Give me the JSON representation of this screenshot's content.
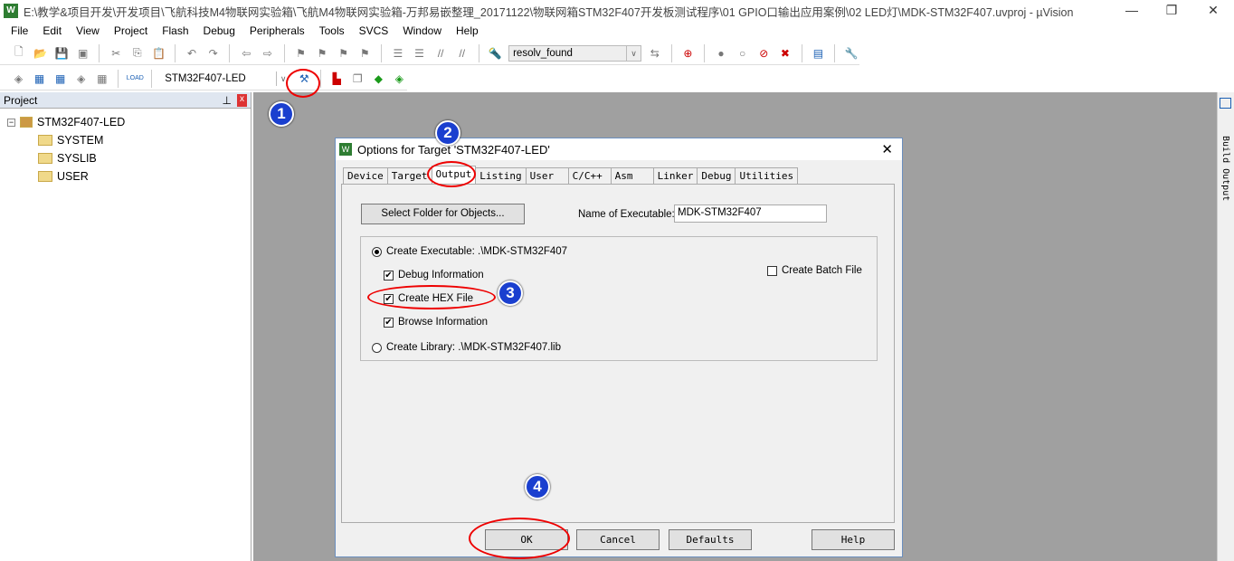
{
  "window": {
    "title": "E:\\教学&项目开发\\开发项目\\飞航科技M4物联网实验箱\\飞航M4物联网实验箱-万邦易嵌整理_20171122\\物联网箱STM32F407开发板测试程序\\01 GPIO口输出应用案例\\02 LED灯\\MDK-STM32F407.uvproj - µVision",
    "logo": "W",
    "minimize": "—",
    "maximize": "❐",
    "close": "✕"
  },
  "menu": [
    "File",
    "Edit",
    "View",
    "Project",
    "Flash",
    "Debug",
    "Peripherals",
    "Tools",
    "SVCS",
    "Window",
    "Help"
  ],
  "toolbar": {
    "find_combo": "resolv_found",
    "target_combo": "STM32F407-LED",
    "load_label": "LOAD"
  },
  "project": {
    "header": "Project",
    "pin": "⊥",
    "close": "x",
    "root": "STM32F407-LED",
    "groups": [
      "SYSTEM",
      "SYSLIB",
      "USER"
    ]
  },
  "build_output": "Build Output",
  "dialog": {
    "title": "Options for Target 'STM32F407-LED'",
    "close": "✕",
    "tabs": [
      "Device",
      "Target",
      "Output",
      "Listing",
      "User",
      "C/C++",
      "Asm",
      "Linker",
      "Debug",
      "Utilities"
    ],
    "active_tab": "Output",
    "select_folder": "Select Folder for Objects...",
    "name_label": "Name of Executable:",
    "name_value": "MDK-STM32F407",
    "create_exe": "Create Executable:  .\\MDK-STM32F407",
    "debug_info": "Debug Information",
    "create_hex": "Create HEX File",
    "browse_info": "Browse Information",
    "create_lib": "Create Library:  .\\MDK-STM32F407.lib",
    "create_batch": "Create Batch File",
    "ok": "OK",
    "cancel": "Cancel",
    "defaults": "Defaults",
    "help": "Help"
  },
  "annotations": [
    "1",
    "2",
    "3",
    "4"
  ],
  "colors": {
    "annotation_circle": "#e00000",
    "badge": "#1a3fcf"
  }
}
